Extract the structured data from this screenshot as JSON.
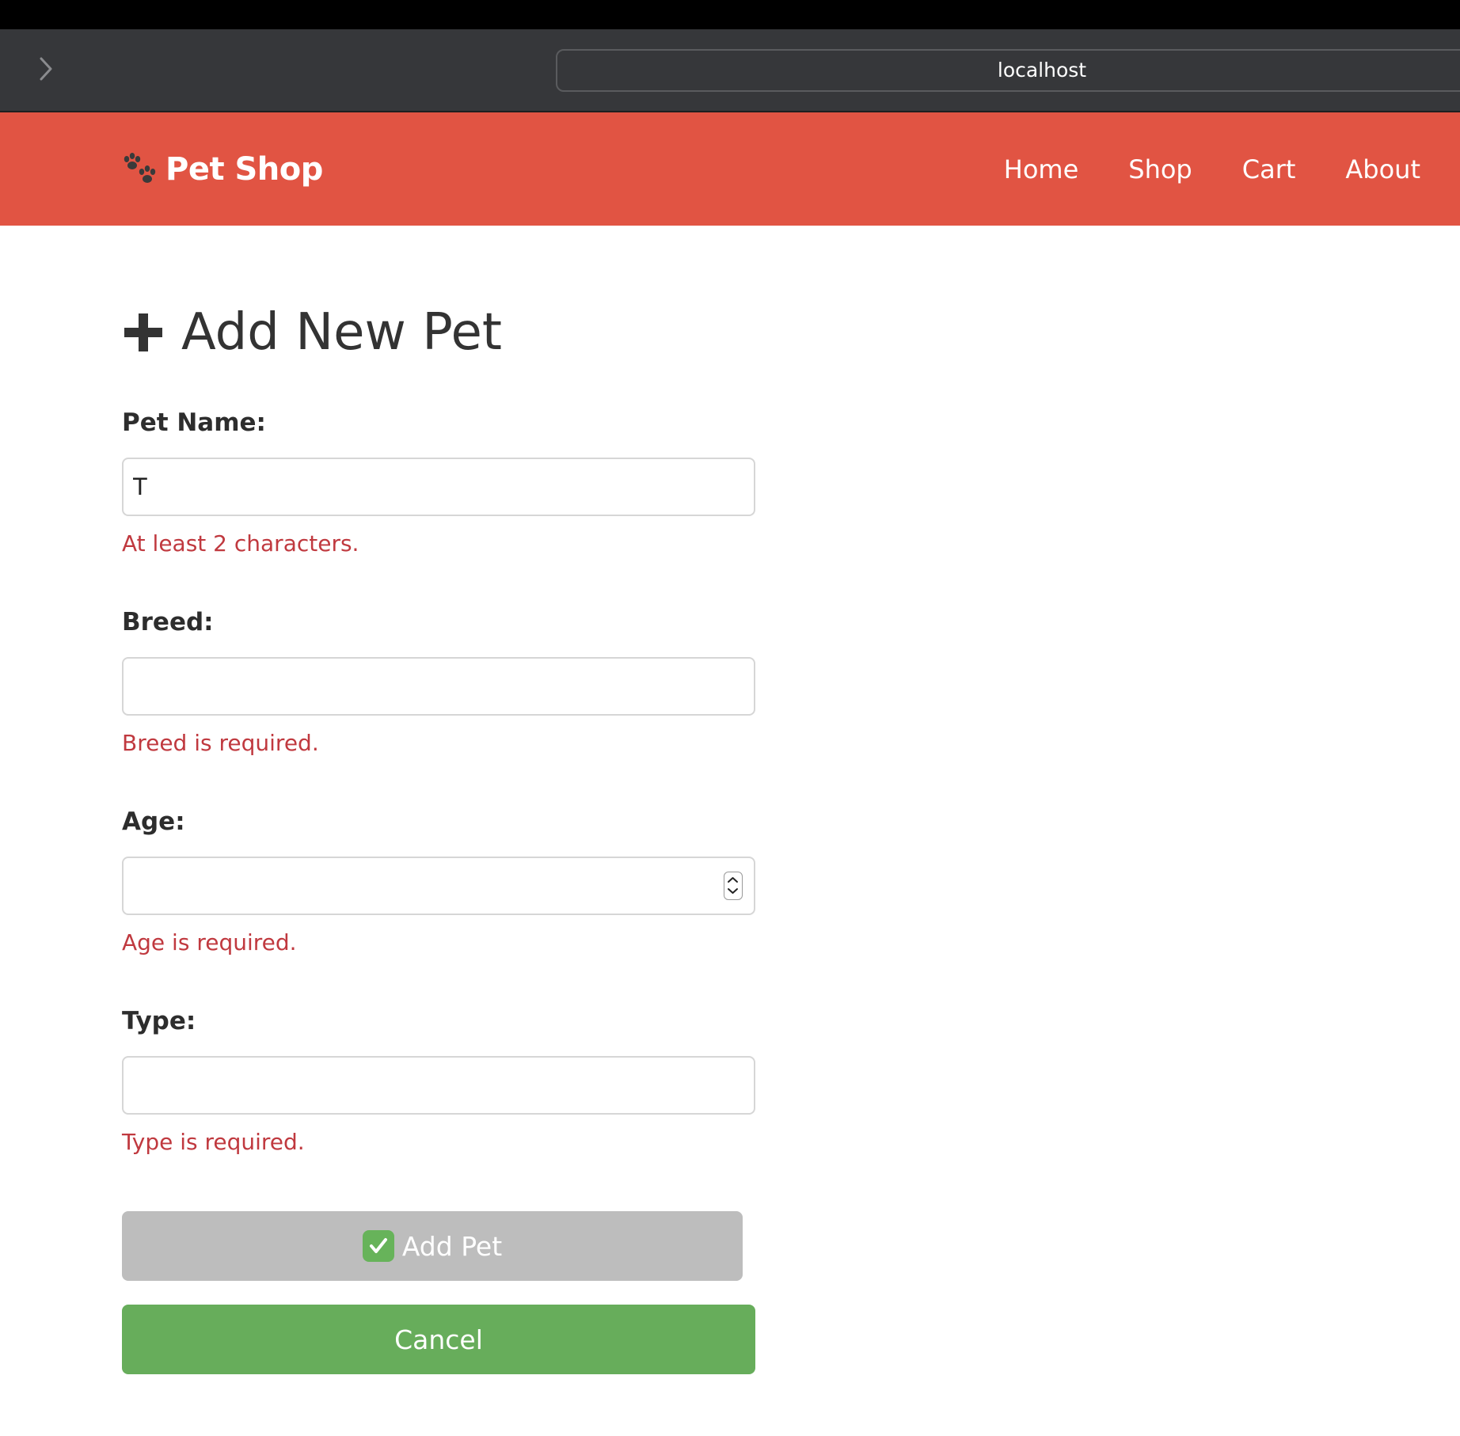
{
  "browser": {
    "address": "localhost",
    "forward_icon": "chevron-right-icon"
  },
  "navbar": {
    "brand_icon": "paw-prints-icon",
    "brand_label": "Pet Shop",
    "links": [
      "Home",
      "Shop",
      "Cart",
      "About"
    ],
    "background_color": "#e15443"
  },
  "page": {
    "title_icon": "plus-icon",
    "title": "Add New Pet"
  },
  "form": {
    "fields": [
      {
        "label": "Pet Name:",
        "value": "T",
        "error": "At least 2 characters."
      },
      {
        "label": "Breed:",
        "value": "",
        "error": "Breed is required."
      },
      {
        "label": "Age:",
        "value": "",
        "error": "Age is required.",
        "input_type": "number"
      },
      {
        "label": "Type:",
        "value": "",
        "error": "Type is required."
      }
    ],
    "submit_label": "Add Pet",
    "submit_icon": "check-mark-button-icon",
    "submit_disabled": true,
    "cancel_label": "Cancel",
    "error_color": "#c0393f",
    "cancel_color": "#67ad5b",
    "disabled_color": "#bdbdbd"
  }
}
